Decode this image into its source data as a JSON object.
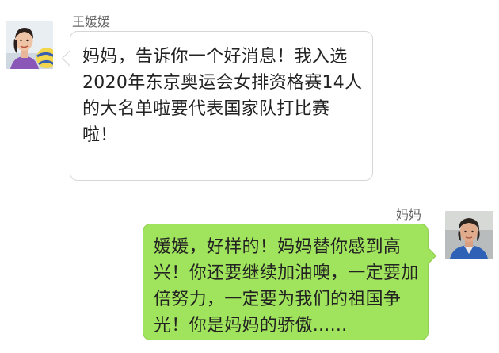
{
  "messages": [
    {
      "sender": "王媛媛",
      "side": "left",
      "avatar_icon": "girl-with-volleyball-avatar",
      "bubble_color": "#ffffff",
      "text": "妈妈，告诉你一个好消息！我入选2020年东京奥运会女排资格赛14人的大名单啦要代表国家队打比赛啦！"
    },
    {
      "sender": "妈妈",
      "side": "right",
      "avatar_icon": "woman-portrait-avatar",
      "bubble_color": "#a0e35c",
      "text": "媛媛，好样的！妈妈替你感到高兴！你还要继续加油噢，一定要加倍努力，一定要为我们的祖国争光！你是妈妈的骄傲......"
    }
  ]
}
